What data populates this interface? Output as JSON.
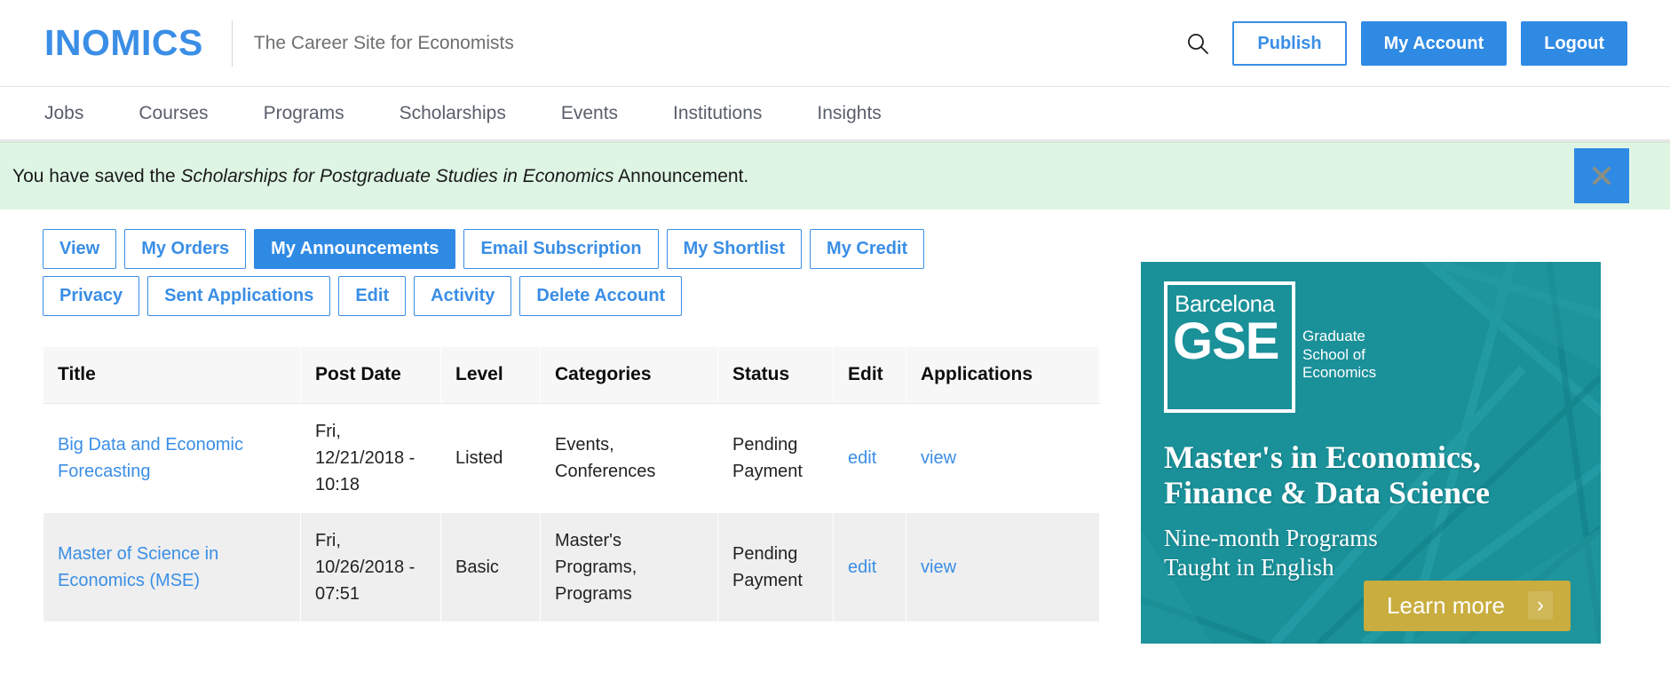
{
  "header": {
    "logo": "INOMICS",
    "tagline": "The Career Site for Economists",
    "search_icon": "search-icon",
    "publish_label": "Publish",
    "my_account_label": "My Account",
    "logout_label": "Logout",
    "accent_color": "#3a8ee6"
  },
  "nav": {
    "items": [
      {
        "label": "Jobs"
      },
      {
        "label": "Courses"
      },
      {
        "label": "Programs"
      },
      {
        "label": "Scholarships"
      },
      {
        "label": "Events"
      },
      {
        "label": "Institutions"
      },
      {
        "label": "Insights"
      }
    ]
  },
  "alert": {
    "prefix": "You have saved the ",
    "emphasis": "Scholarships for Postgraduate Studies in Economics",
    "suffix": " Announcement.",
    "close_icon": "close-icon",
    "background_color": "#def5e4",
    "close_button_color": "#2f8ae4"
  },
  "tabs": [
    {
      "label": "View",
      "active": false
    },
    {
      "label": "My Orders",
      "active": false
    },
    {
      "label": "My Announcements",
      "active": true
    },
    {
      "label": "Email Subscription",
      "active": false
    },
    {
      "label": "My Shortlist",
      "active": false
    },
    {
      "label": "My Credit",
      "active": false
    },
    {
      "label": "Privacy",
      "active": false
    },
    {
      "label": "Sent Applications",
      "active": false
    },
    {
      "label": "Edit",
      "active": false
    },
    {
      "label": "Activity",
      "active": false
    },
    {
      "label": "Delete Account",
      "active": false
    }
  ],
  "table": {
    "columns": [
      "Title",
      "Post Date",
      "Level",
      "Categories",
      "Status",
      "Edit",
      "Applications"
    ],
    "rows": [
      {
        "title": "Big Data and Economic Forecasting",
        "post_date": "Fri, 12/21/2018 - 10:18",
        "level": "Listed",
        "categories": "Events, Conferences",
        "status": "Pending Payment",
        "edit": "edit",
        "applications": "view"
      },
      {
        "title": "Master of Science in Economics (MSE)",
        "post_date": "Fri, 10/26/2018 - 07:51",
        "level": "Basic",
        "categories": "Master's Programs, Programs",
        "status": "Pending Payment",
        "edit": "edit",
        "applications": "view"
      }
    ]
  },
  "ad": {
    "logo_city": "Barcelona",
    "logo_abbr": "GSE",
    "logo_sub": "Graduate\nSchool of\nEconomics",
    "headline_line1_light": "Master's in ",
    "headline_line1_bold": "Economics,",
    "headline_line2": "Finance & Data Science",
    "subline1": "Nine-month Programs",
    "subline2": "Taught in English",
    "cta_label": "Learn more",
    "cta_chevron": "›",
    "bg_color": "#1a9099",
    "cta_color": "#c9ad3e"
  }
}
